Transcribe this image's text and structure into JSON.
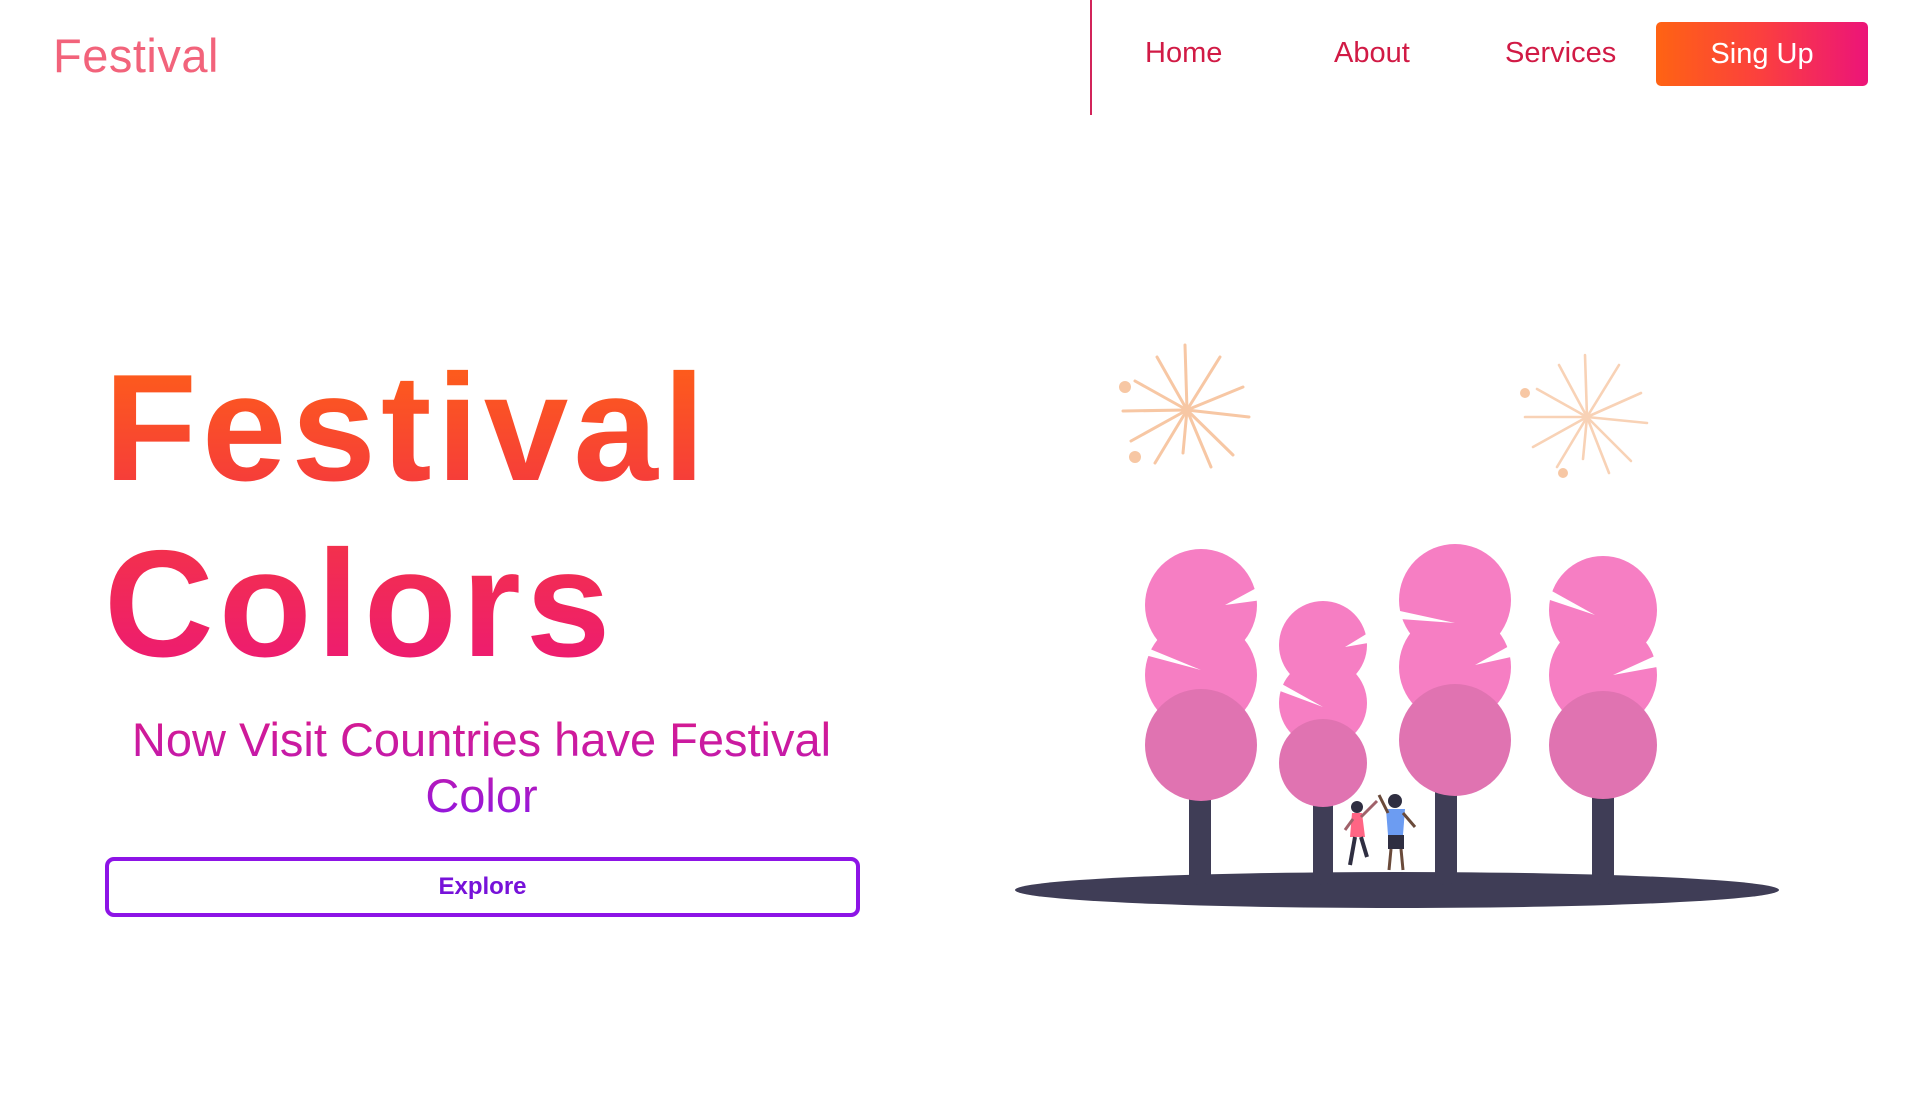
{
  "header": {
    "brand": "Festival",
    "nav": [
      {
        "label": "Home"
      },
      {
        "label": "About"
      },
      {
        "label": "Services"
      }
    ],
    "signup_label": "Sing Up"
  },
  "hero": {
    "title_line1": "Festival",
    "title_line2": "Colors",
    "subtitle": "Now Visit Countries have Festival Color",
    "explore_label": "Explore"
  },
  "colors": {
    "brand": "#f2637b",
    "nav_text": "#d11a45",
    "accent_orange": "#ff6313",
    "accent_pink": "#ec1479",
    "explore_border": "#8d14e6",
    "tree_pink": "#f67ec3",
    "tree_shade": "#e073b1",
    "ground": "#3f3d56",
    "firework": "#f7c7a4"
  },
  "illustration": {
    "icon": "festival-trees-illustration"
  }
}
